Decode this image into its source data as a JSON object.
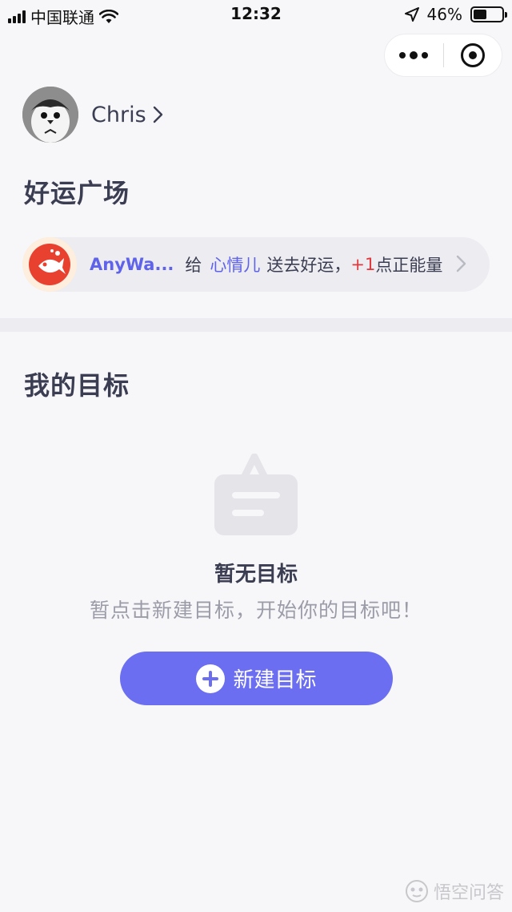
{
  "status_bar": {
    "carrier": "中国联通",
    "time": "12:32",
    "battery": "46%",
    "battery_level": 0.46
  },
  "profile": {
    "name": "Chris"
  },
  "luck_square": {
    "title": "好运广场",
    "feed": {
      "user": "AnyWa...",
      "give": "给",
      "target": "心情儿",
      "action": "送去好运，",
      "plus": "+1",
      "reward": "点正能量"
    }
  },
  "goals": {
    "title": "我的目标",
    "empty_title": "暂无目标",
    "empty_subtitle": "暂点击新建目标，开始你的目标吧！",
    "new_button": "新建目标"
  },
  "watermark": {
    "text": "悟空问答"
  },
  "colors": {
    "accent": "#6b6ef0",
    "link": "#5f63ea",
    "plus": "#e0393e",
    "text": "#3b3e52",
    "muted": "#9b9ca8"
  },
  "icons": {
    "signal": "signal-icon",
    "wifi": "wifi-icon",
    "location": "location-arrow-icon",
    "battery": "battery-icon",
    "more": "more-dots-icon",
    "target": "target-icon",
    "chevron": "chevron-right-icon",
    "empty": "empty-board-icon",
    "plus": "plus-circle-icon"
  }
}
